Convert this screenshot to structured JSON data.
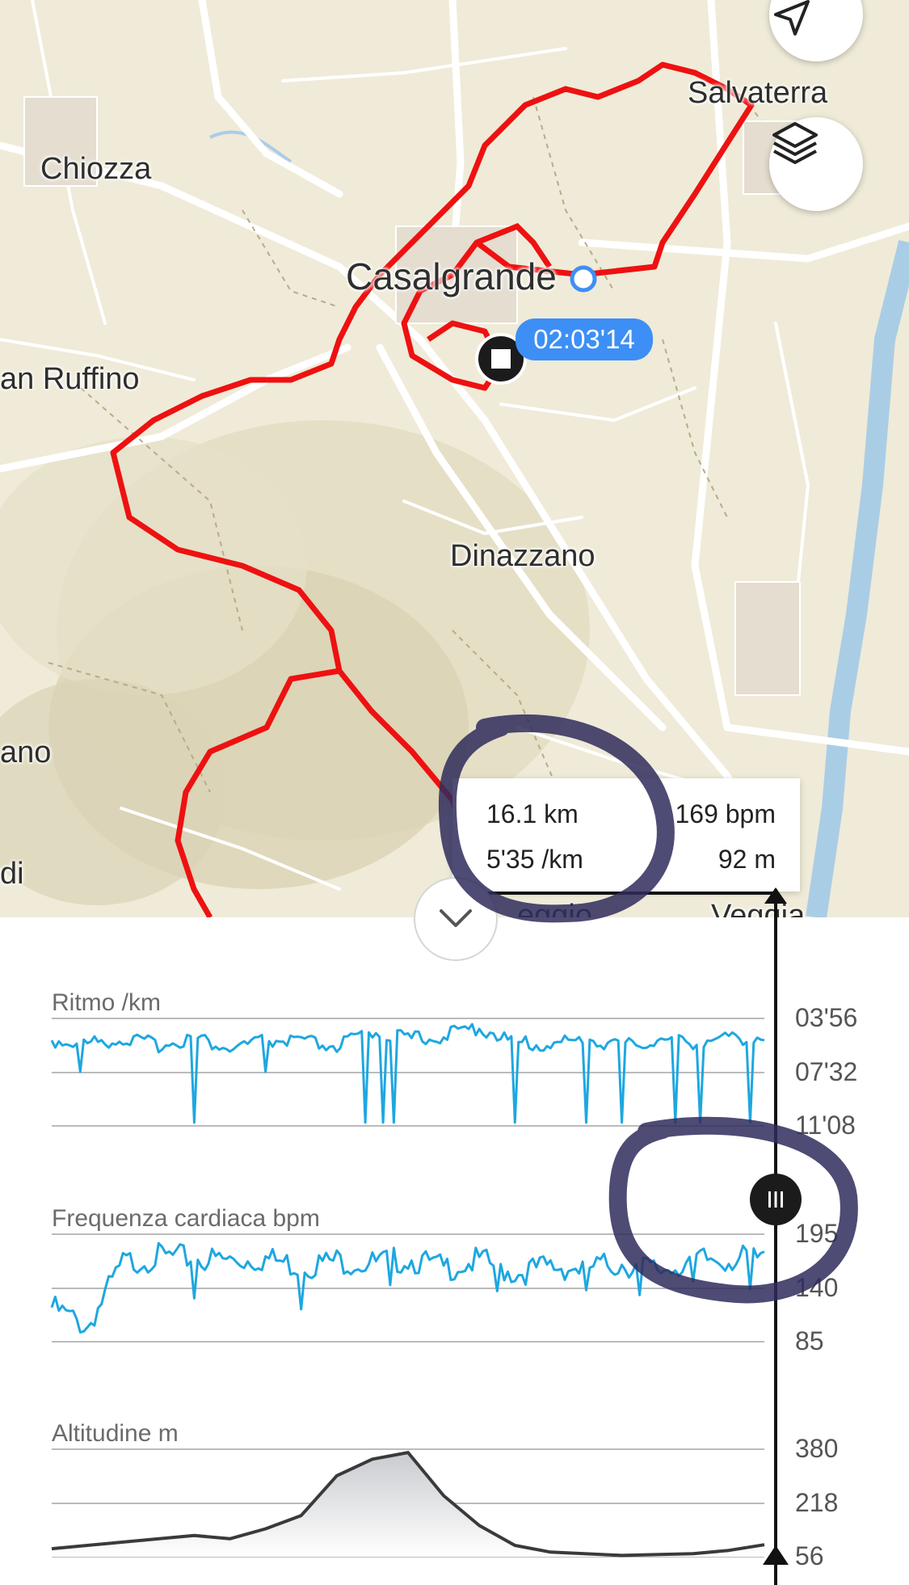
{
  "map": {
    "places": {
      "chiozza": "Chiozza",
      "salvaterra": "Salvaterra",
      "casalgrande": "Casalgrande",
      "san_ruffino": "an Ruffino",
      "dinazzano": "Dinazzano",
      "left_ano": "ano",
      "left_di": "di",
      "bottom_mid": "eggio",
      "bottom_right": "Veggia"
    },
    "elapsed_time": "02:03'14",
    "route_color": "#ee1111",
    "buttons": {
      "locate_icon": "navigation-arrow-icon",
      "layers_icon": "layers-icon"
    }
  },
  "info": {
    "distance": "16.1 km",
    "heart_rate": "169 bpm",
    "pace": "5'35 /km",
    "altitude": "92 m"
  },
  "charts": {
    "pace": {
      "title": "Ritmo /km",
      "ticks": [
        "03'56",
        "07'32",
        "11'08"
      ]
    },
    "heart": {
      "title": "Frequenza cardiaca bpm",
      "ticks": [
        "195",
        "140",
        "85"
      ]
    },
    "altitude": {
      "title": "Altitudine m",
      "ticks": [
        "380",
        "218",
        "56"
      ]
    },
    "series_color": "#1ea7e0",
    "collapse_icon": "chevron-down-icon",
    "scrubber_icon": "drag-handle-icon"
  },
  "chart_data": [
    {
      "type": "line",
      "title": "Ritmo /km",
      "ylim_labels": [
        "03'56",
        "11'08"
      ],
      "x": [
        0,
        0.05,
        0.1,
        0.15,
        0.2,
        0.25,
        0.3,
        0.35,
        0.4,
        0.45,
        0.5,
        0.55,
        0.6,
        0.65,
        0.7,
        0.75,
        0.8,
        0.85,
        0.9,
        0.95,
        1.0
      ],
      "values_min": [
        5.4,
        5.6,
        5.3,
        5.7,
        5.2,
        6.0,
        5.4,
        5.5,
        5.8,
        4.8,
        5.3,
        5.1,
        4.5,
        5.6,
        5.7,
        5.3,
        5.8,
        5.4,
        5.5,
        5.3,
        5.1
      ]
    },
    {
      "type": "line",
      "title": "Frequenza cardiaca bpm",
      "ylim": [
        85,
        195
      ],
      "x": [
        0,
        0.05,
        0.1,
        0.15,
        0.2,
        0.25,
        0.3,
        0.35,
        0.4,
        0.45,
        0.5,
        0.55,
        0.6,
        0.65,
        0.7,
        0.75,
        0.8,
        0.85,
        0.9,
        0.95,
        1.0
      ],
      "values": [
        120,
        100,
        165,
        172,
        170,
        168,
        170,
        162,
        168,
        165,
        170,
        160,
        168,
        155,
        162,
        160,
        165,
        158,
        168,
        170,
        169
      ]
    },
    {
      "type": "area",
      "title": "Altitudine m",
      "ylim": [
        56,
        380
      ],
      "x": [
        0,
        0.1,
        0.2,
        0.25,
        0.3,
        0.35,
        0.4,
        0.45,
        0.5,
        0.55,
        0.6,
        0.65,
        0.7,
        0.8,
        0.9,
        0.95,
        1.0
      ],
      "values": [
        80,
        100,
        120,
        110,
        140,
        180,
        300,
        350,
        370,
        240,
        150,
        90,
        70,
        60,
        65,
        75,
        92
      ]
    }
  ]
}
